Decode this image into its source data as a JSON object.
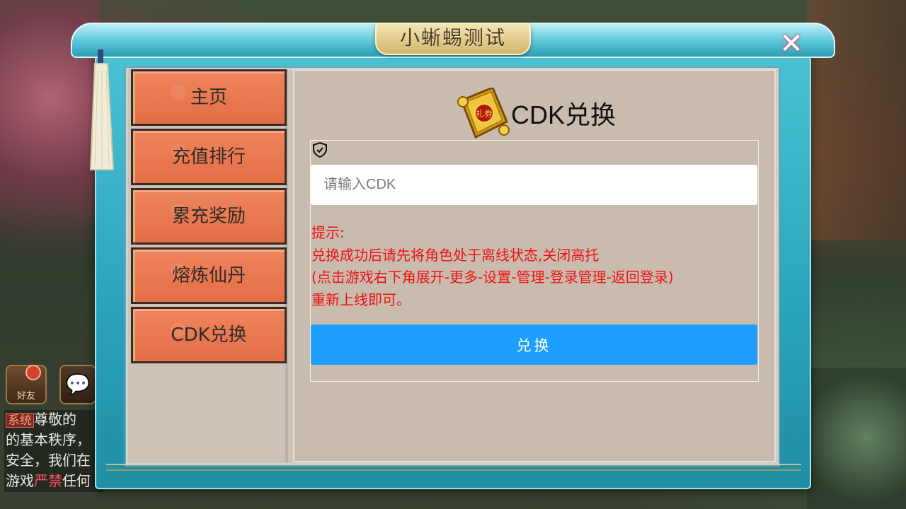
{
  "window": {
    "title": "小蜥蜴测试",
    "close_glyph": "✕"
  },
  "sidebar": {
    "items": [
      {
        "label": "主页"
      },
      {
        "label": "充值排行"
      },
      {
        "label": "累充奖励"
      },
      {
        "label": "熔炼仙丹"
      },
      {
        "label": "CDK兑换"
      }
    ]
  },
  "cdk": {
    "title": "CDK兑换",
    "icon_text": "礼券",
    "input_placeholder": "请输入CDK",
    "hint_lines": [
      "提示:",
      "兑换成功后请先将角色处于离线状态,关闭高托",
      "(点击游戏右下角展开-更多-设置-管理-登录管理-返回登录)",
      "重新上线即可。"
    ],
    "button_label": "兑换"
  },
  "hud": {
    "friend_label": "好友",
    "chat_lines": [
      {
        "tag": "系统",
        "text": "尊敬的"
      },
      {
        "text": "的基本秩序，"
      },
      {
        "text": "安全，我们在"
      },
      {
        "prefix": "游戏",
        "red": "严禁",
        "suffix": "任何"
      }
    ]
  },
  "colors": {
    "nav_button": "#e8754c",
    "redeem_button": "#1e9fff",
    "hint_text": "#f01010",
    "panel_bg": "#c9bcae",
    "frame_teal": "#2aa4bb"
  }
}
